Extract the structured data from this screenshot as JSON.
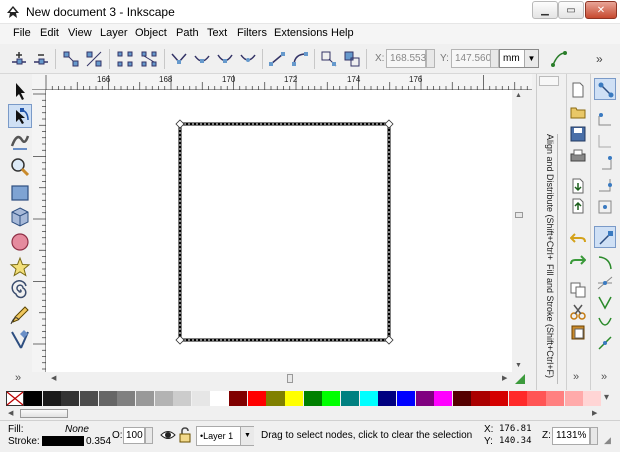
{
  "window": {
    "title": "New document 3 - Inkscape"
  },
  "menu": [
    "File",
    "Edit",
    "View",
    "Layer",
    "Object",
    "Path",
    "Text",
    "Filters",
    "Extensions",
    "Help"
  ],
  "toolbar": {
    "x_label": "X:",
    "x_value": "168.553",
    "y_label": "Y:",
    "y_value": "147.560",
    "unit": "mm",
    "overflow": "»"
  },
  "ruler": {
    "h_labels": [
      "166",
      "168",
      "170",
      "172",
      "174",
      "176"
    ]
  },
  "dock": {
    "tab_align": "Align and Distribute (Shift+Ctrl+A)",
    "tab_fill": "Fill and Stroke (Shift+Ctrl+F)"
  },
  "palette": {
    "colors": [
      "#000000",
      "#1a1a1a",
      "#333333",
      "#4d4d4d",
      "#666666",
      "#808080",
      "#999999",
      "#b3b3b3",
      "#cccccc",
      "#e6e6e6",
      "#ffffff",
      "#800000",
      "#ff0000",
      "#808000",
      "#ffff00",
      "#008000",
      "#00ff00",
      "#008080",
      "#00ffff",
      "#000080",
      "#0000ff",
      "#800080",
      "#ff00ff",
      "#550000",
      "#aa0000",
      "#d40000",
      "#ff2a2a",
      "#ff5555",
      "#ff8080",
      "#ffaaaa",
      "#ffd5d5"
    ]
  },
  "status": {
    "fill_label": "Fill:",
    "fill_value": "None",
    "stroke_label": "Stroke:",
    "stroke_width": "0.354",
    "opacity_label": "O:",
    "opacity_value": "100",
    "layer": "•Layer 1",
    "message": "Drag to select nodes, click to clear the selection",
    "cursor_x_label": "X:",
    "cursor_x": "176.81",
    "cursor_y_label": "Y:",
    "cursor_y": "140.34",
    "zoom_label": "Z:",
    "zoom": "1131%"
  }
}
